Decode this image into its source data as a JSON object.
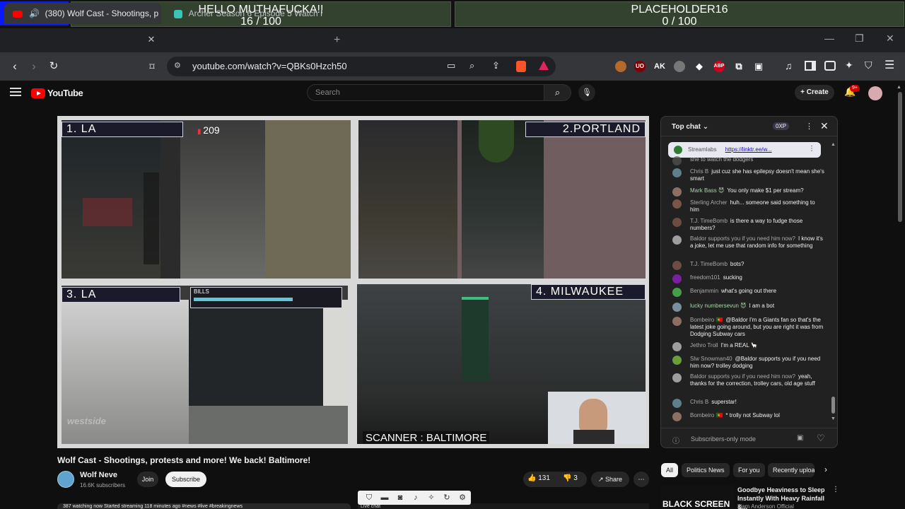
{
  "overlay": {
    "goal1_title": "HELLO MUTHAFUCKA!!",
    "goal1_progress": "16 / 100",
    "goal1_fraction": 0.16,
    "goal2_title": "PLACEHOLDER16",
    "goal2_progress": "0 / 100",
    "goal2_fraction": 0.0
  },
  "browser": {
    "tabs": [
      {
        "label": "(380) Wolf Cast - Shootings, p",
        "active": true
      },
      {
        "label": "Archer Season 6 Episode 5 Watch Fre",
        "active": false
      }
    ],
    "new_tab": "+",
    "url": "youtube.com/watch?v=QBKs0Hzch50",
    "window_controls": [
      "—",
      "❐",
      "✕"
    ],
    "extensions": [
      {
        "icon": "pin-icon",
        "color": "#b36b2c",
        "text": ""
      },
      {
        "icon": "ublock-icon",
        "color": "#800000",
        "text": "UO"
      },
      {
        "icon": "ak-icon",
        "color": "#35363a",
        "text": "AK"
      },
      {
        "icon": "globe-icon",
        "color": "#777",
        "text": ""
      },
      {
        "icon": "diamond-icon",
        "color": "#35363a",
        "text": "◆"
      },
      {
        "icon": "adblock-icon",
        "color": "#d0021b",
        "text": "ABP"
      },
      {
        "icon": "puzzle-icon",
        "color": "#35363a",
        "text": "⧉"
      },
      {
        "icon": "capture-icon",
        "color": "#35363a",
        "text": "▣"
      }
    ]
  },
  "youtube": {
    "logo_text": "YouTube",
    "search_placeholder": "Search",
    "create_label": "Create",
    "notif_badge": "9+",
    "video": {
      "panes": [
        {
          "label": "1. LA",
          "viewers": "209"
        },
        {
          "label": "2.PORTLAND"
        },
        {
          "label": "3. LA",
          "hud": "BILLS"
        },
        {
          "label": "4. MILWAUKEE"
        }
      ],
      "scanner": "SCANNER : BALTIMORE",
      "watermark": "westside"
    },
    "title": "Wolf Cast - Shootings, protests and more! We back! Baltimore!",
    "channel": {
      "name": "Wolf Neve",
      "subscribers": "16.6K subscribers",
      "join": "Join",
      "subscribe": "Subscribe"
    },
    "actions": {
      "likes": "131",
      "dislikes": "3",
      "share": "Share",
      "more": "⋯"
    },
    "description_peek": "387 watching now  Started streaming 118 minutes ago  #news #live #breakingnews",
    "live_chat_peek": "Live chat"
  },
  "chat": {
    "header": "Top chat",
    "points": "0XP",
    "pinned": {
      "author": "Streamlabs",
      "text": "https://linktr.ee/w..."
    },
    "messages": [
      {
        "author": "",
        "text": "she to watch the dodgers",
        "color": "#555"
      },
      {
        "author": "Chris B",
        "text": "just cuz she has epilepsy doesn't mean she's smart",
        "color": "#607d8b"
      },
      {
        "author": "Mark Bass 😈",
        "text": "You only make $1 per stream?",
        "color": "#8d6e63",
        "author_color": "#a5d6a7"
      },
      {
        "author": "Sterling Archer",
        "text": "huh... someone said something to him",
        "color": "#795548"
      },
      {
        "author": "T.J. TimeBomb",
        "text": "is there a way to fudge those numbers?",
        "color": "#6d4c41"
      },
      {
        "author": "Baldor supports you if you need him now?",
        "text": "I know it's a joke, let me use that random info for something",
        "color": "#9e9e9e"
      },
      {
        "author": "T.J. TimeBomb",
        "text": "bots?",
        "color": "#6d4c41"
      },
      {
        "author": "freedom101",
        "text": "sucking",
        "color": "#7b1fa2"
      },
      {
        "author": "Benjammin",
        "text": "what's going out there",
        "color": "#43a047"
      },
      {
        "author": "lucky numbersevun 😈",
        "text": "I am a bot",
        "color": "#78909c",
        "author_color": "#a5d6a7"
      },
      {
        "author": "Bombeiro 🇵🇹",
        "text": "@Baldor I'm a Giants fan so that's the latest joke going around, but you are right it was from Dodging Subway cars",
        "color": "#8d6e63"
      },
      {
        "author": "Jethro Troll",
        "text": "I'm a REAL 🦙",
        "color": "#9e9e9e"
      },
      {
        "author": "Slw Snowman40",
        "text": "@Baldor supports you if you need him now? trolley dodging",
        "color": "#689f38"
      },
      {
        "author": "Baldor supports you if you need him now?",
        "text": "yeah, thanks for the correction, trolley cars, old age stuff",
        "color": "#9e9e9e"
      },
      {
        "author": "Chris B",
        "text": "superstar!",
        "color": "#607d8b"
      },
      {
        "author": "Bombeiro 🇵🇹",
        "text": "* trolly not Subway lol",
        "color": "#8d6e63"
      }
    ],
    "footer_mode": "Subscribers-only mode"
  },
  "recommendations": {
    "chips": [
      "All",
      "Politics News",
      "For you",
      "Recently uploa"
    ],
    "items": [
      {
        "thumb_text": "BLACK SCREEN",
        "title": "Goodbye Heaviness to Sleep Instantly With Heavy Rainfall &...",
        "channel": "Liam Anderson Official"
      }
    ]
  }
}
